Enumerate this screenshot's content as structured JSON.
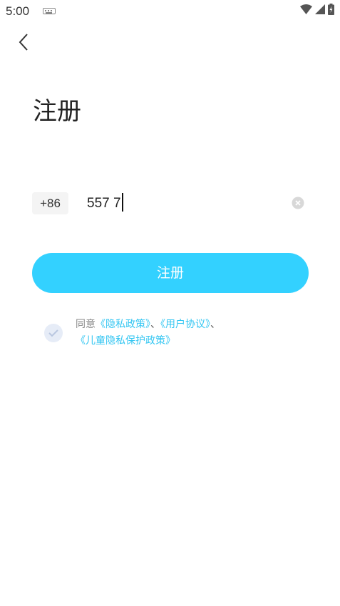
{
  "status_bar": {
    "time": "5:00"
  },
  "page": {
    "title": "注册"
  },
  "phone_form": {
    "country_code": "+86",
    "phone_value": "557 7"
  },
  "register_button": {
    "label": "注册"
  },
  "agreement": {
    "prefix": "同意",
    "privacy_policy": "《隐私政策》",
    "separator1": "、",
    "user_agreement": "《用户协议》",
    "separator2": "、",
    "children_privacy": "《儿童隐私保护政策》",
    "checkbox_checked": true
  },
  "colors": {
    "accent": "#33d1ff",
    "link": "#33c6f2",
    "checkbox_bg": "#e6ecf7"
  }
}
